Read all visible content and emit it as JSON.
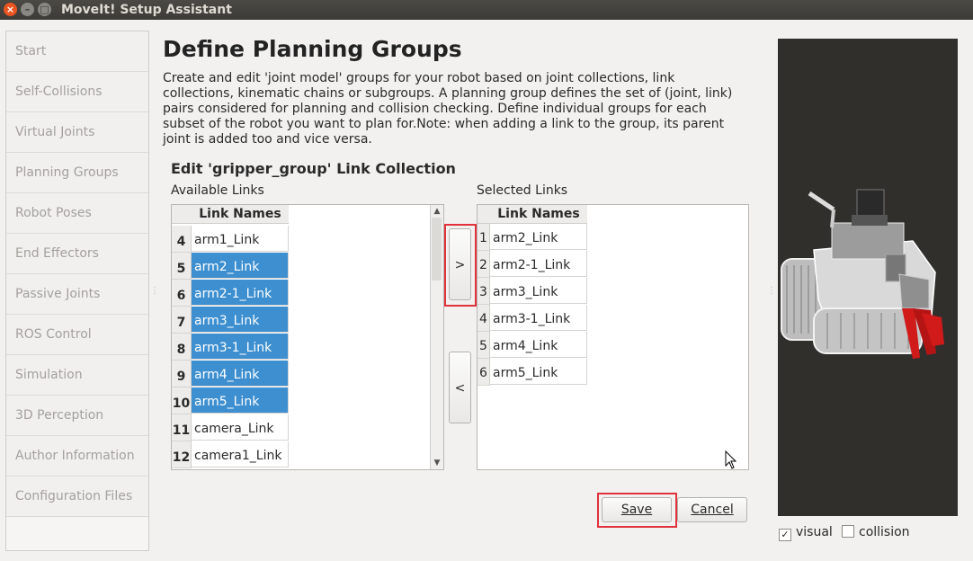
{
  "window": {
    "title": "MoveIt! Setup Assistant"
  },
  "sidebar": {
    "items": [
      {
        "label": "Start"
      },
      {
        "label": "Self-Collisions"
      },
      {
        "label": "Virtual Joints"
      },
      {
        "label": "Planning Groups"
      },
      {
        "label": "Robot Poses"
      },
      {
        "label": "End Effectors"
      },
      {
        "label": "Passive Joints"
      },
      {
        "label": "ROS Control"
      },
      {
        "label": "Simulation"
      },
      {
        "label": "3D Perception"
      },
      {
        "label": "Author Information"
      },
      {
        "label": "Configuration Files"
      }
    ]
  },
  "main": {
    "title": "Define Planning Groups",
    "description": "Create and edit 'joint model' groups for your robot based on joint collections, link collections, kinematic chains or subgroups. A planning group defines the set of (joint, link) pairs considered for planning and collision checking. Define individual groups for each subset of the robot you want to plan for.Note: when adding a link to the group, its parent joint is added too and vice versa.",
    "subtitle": "Edit 'gripper_group' Link Collection"
  },
  "available": {
    "label": "Available Links",
    "header": "Link Names",
    "rows": [
      {
        "num": "4",
        "name": "arm1_Link",
        "selected": false
      },
      {
        "num": "5",
        "name": "arm2_Link",
        "selected": true
      },
      {
        "num": "6",
        "name": "arm2-1_Link",
        "selected": true
      },
      {
        "num": "7",
        "name": "arm3_Link",
        "selected": true
      },
      {
        "num": "8",
        "name": "arm3-1_Link",
        "selected": true
      },
      {
        "num": "9",
        "name": "arm4_Link",
        "selected": true
      },
      {
        "num": "10",
        "name": "arm5_Link",
        "selected": true
      },
      {
        "num": "11",
        "name": "camera_Link",
        "selected": false
      },
      {
        "num": "12",
        "name": "camera1_Link",
        "selected": false
      }
    ]
  },
  "selected": {
    "label": "Selected Links",
    "header": "Link Names",
    "rows": [
      {
        "num": "1",
        "name": "arm2_Link"
      },
      {
        "num": "2",
        "name": "arm2-1_Link"
      },
      {
        "num": "3",
        "name": "arm3_Link"
      },
      {
        "num": "4",
        "name": "arm3-1_Link"
      },
      {
        "num": "5",
        "name": "arm4_Link"
      },
      {
        "num": "6",
        "name": "arm5_Link"
      }
    ]
  },
  "buttons": {
    "add": ">",
    "remove": "<",
    "save": "Save",
    "cancel": "Cancel"
  },
  "viewer": {
    "visual_label": "visual",
    "visual_checked": true,
    "collision_label": "collision",
    "collision_checked": false
  },
  "colors": {
    "selection": "#3d8fd0",
    "highlight": "#e0323a",
    "close_button": "#e95420"
  }
}
